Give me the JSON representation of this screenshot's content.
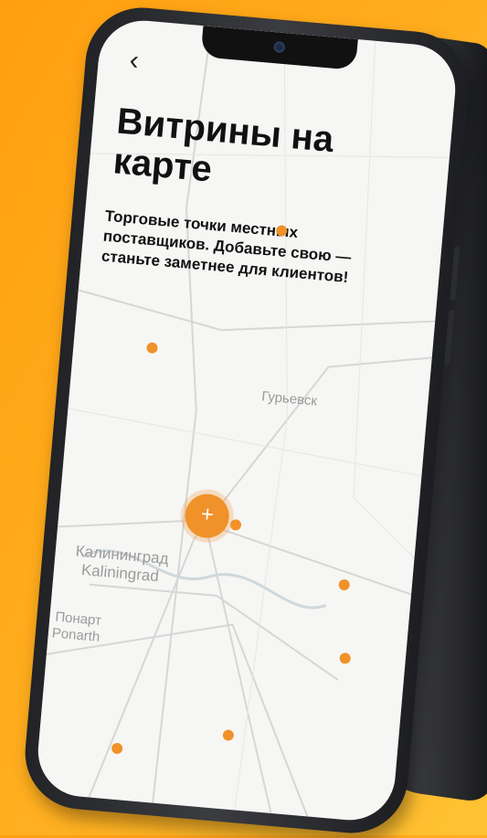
{
  "screen": {
    "back_icon": "‹",
    "title": "Витрины на карте",
    "subtitle": "Торговые точки местных поставщиков. Добавьте свою — станьте заметнее для клиентов!"
  },
  "map": {
    "cluster_label": "+",
    "places": {
      "guryevsk": "Гурьевск",
      "kaliningrad_ru": "Калининград",
      "kaliningrad_en": "Kaliningrad",
      "ponart_ru": "Понарт",
      "ponart_en": "Ponarth"
    },
    "pin_color": "#f0912a"
  },
  "colors": {
    "background": "#ffa915",
    "accent": "#f0912a"
  }
}
